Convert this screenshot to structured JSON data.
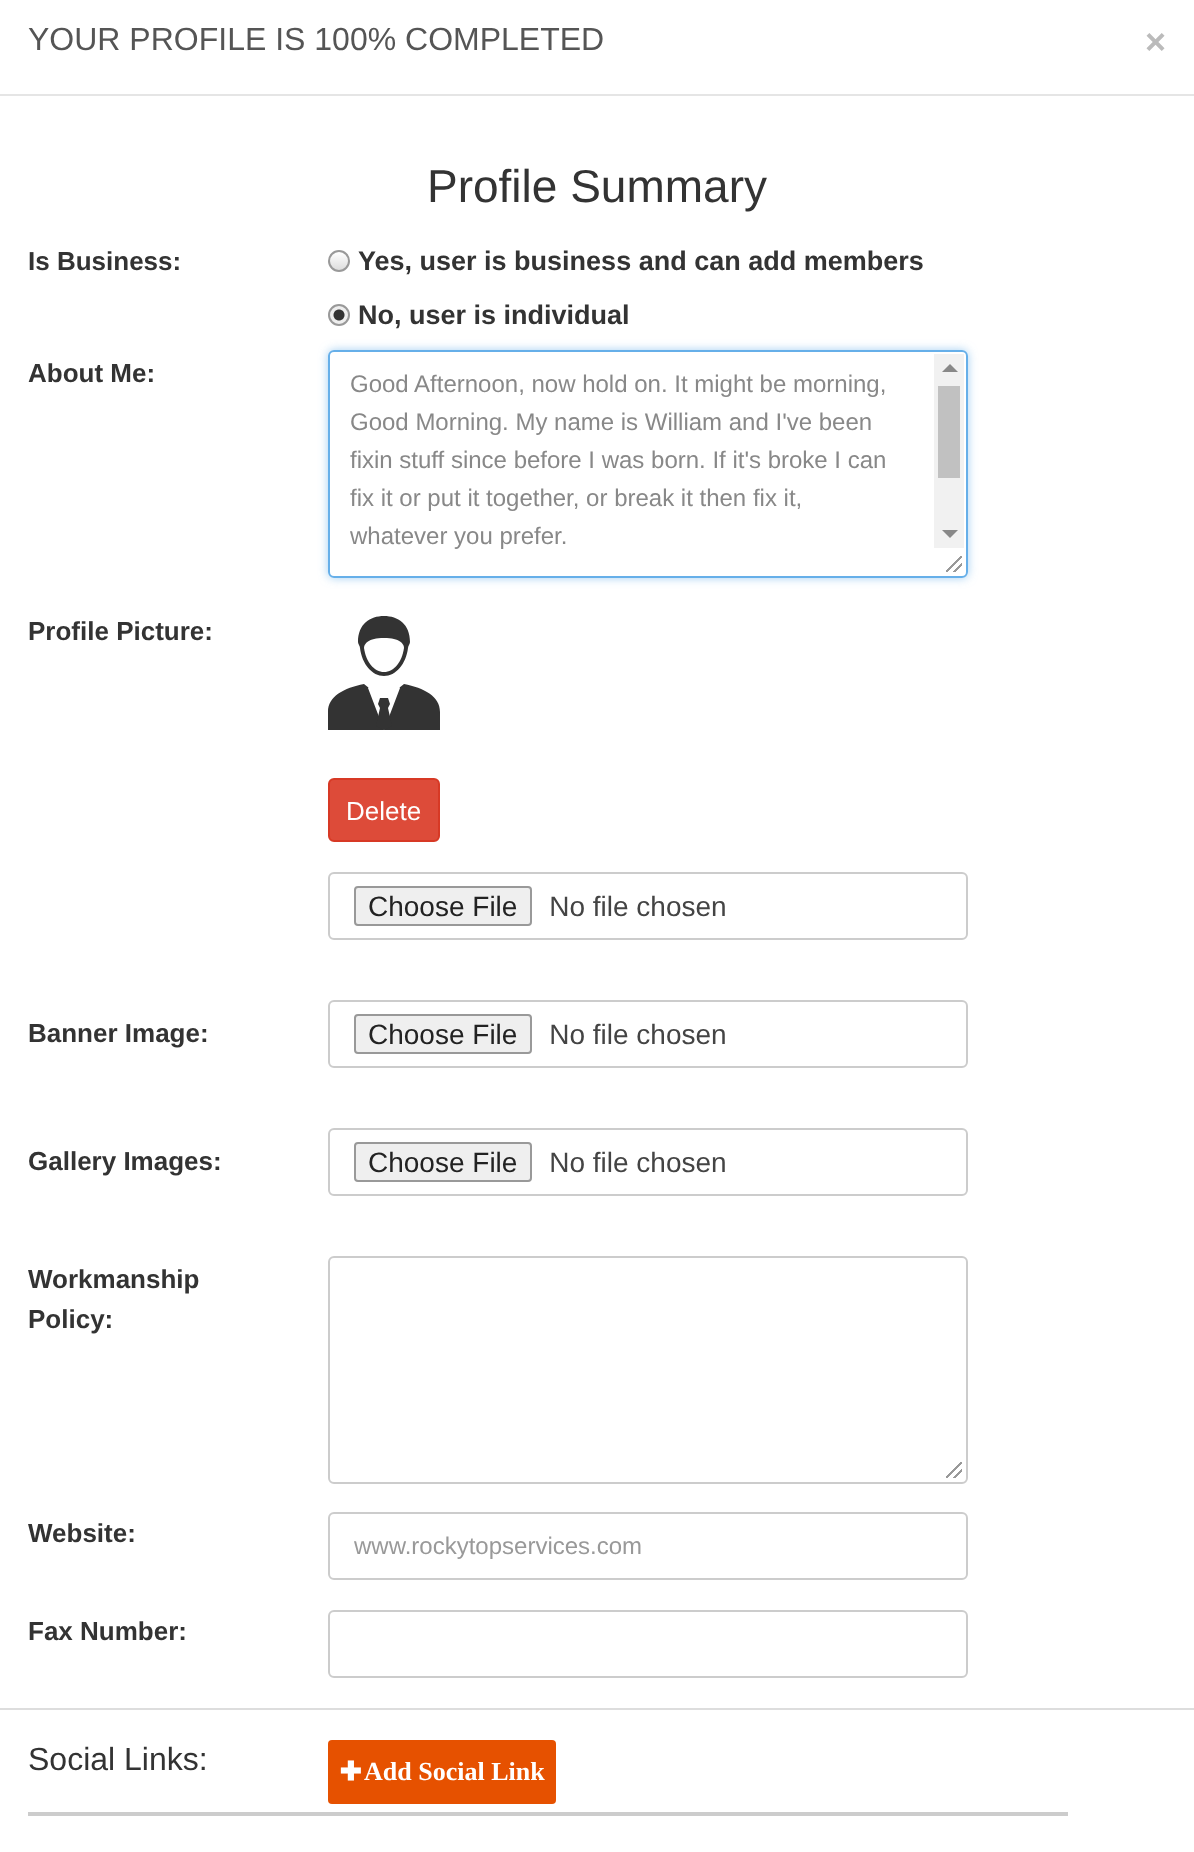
{
  "header": {
    "title": "YOUR PROFILE IS 100% COMPLETED",
    "close": "×"
  },
  "heading": "Profile Summary",
  "fields": [
    {
      "kind": "radio",
      "label": "Is Business:",
      "options": [
        {
          "label": "Yes, user is business and can add members",
          "selected": false
        },
        {
          "label": "No, user is individual",
          "selected": true
        }
      ]
    },
    {
      "kind": "textarea",
      "label": "About Me:",
      "value": "Good Afternoon, now hold on. It might be morning, Good Morning. My name is William and I've been fixin stuff since before I was born. If it's broke I can fix it or put it together, or break it then fix it, whatever you prefer."
    },
    {
      "kind": "picture",
      "label": "Profile Picture:",
      "delete": "Delete",
      "button": "Choose File",
      "status": "No file chosen"
    },
    {
      "kind": "file",
      "label": "Banner Image:",
      "button": "Choose File",
      "status": "No file chosen"
    },
    {
      "kind": "file",
      "label": "Gallery Images:",
      "button": "Choose File",
      "status": "No file chosen"
    },
    {
      "kind": "textarea",
      "label": "Workmanship Policy:"
    },
    {
      "kind": "input",
      "label": "Website:",
      "value": "www.rockytopservices.com"
    },
    {
      "kind": "input",
      "label": "Fax Number:"
    }
  ],
  "social": {
    "label": "Social Links:",
    "button": "Add Social Link",
    "icon": "✚"
  }
}
